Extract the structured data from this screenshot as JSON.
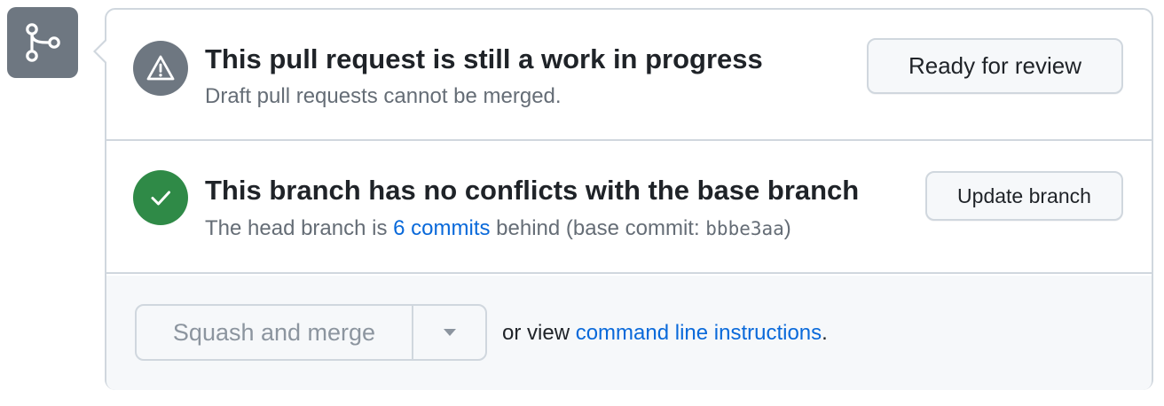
{
  "icons": {
    "merge_badge": "git-branch-icon",
    "draft_status": "alert-triangle-icon",
    "branch_status": "check-icon",
    "dropdown": "triangle-down-icon"
  },
  "colors": {
    "badge_gray": "#6e7781",
    "success_green": "#2f8a47",
    "link_blue": "#0969da",
    "muted_text": "#656d76",
    "border": "#d0d7de",
    "button_bg": "#f6f8fa"
  },
  "draft": {
    "title": "This pull request is still a work in progress",
    "subtitle": "Draft pull requests cannot be merged.",
    "ready_button_label": "Ready for review"
  },
  "branch": {
    "title": "This branch has no conflicts with the base branch",
    "subtitle_prefix": "The head branch is ",
    "commits_link": "6 commits",
    "subtitle_middle": " behind (base commit: ",
    "base_commit": "bbbe3aa",
    "subtitle_suffix": ")",
    "update_button_label": "Update branch"
  },
  "merge": {
    "merge_button_label": "Squash and merge",
    "hint_prefix": "or view ",
    "cli_link": "command line instructions",
    "hint_suffix": "."
  }
}
